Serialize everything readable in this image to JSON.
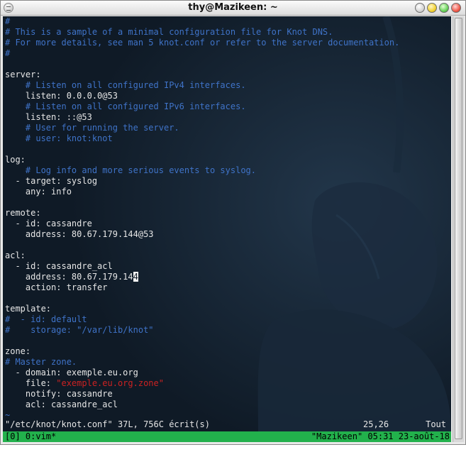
{
  "window": {
    "title": "thy@Mazikeen: ~"
  },
  "editor": {
    "lines": [
      {
        "text": "#",
        "kind": "comment"
      },
      {
        "text": "# This is a sample of a minimal configuration file for Knot DNS.",
        "kind": "comment"
      },
      {
        "text": "# For more details, see man 5 knot.conf or refer to the server documentation.",
        "kind": "comment"
      },
      {
        "text": "#",
        "kind": "comment"
      },
      {
        "text": "",
        "kind": "text"
      },
      {
        "text": "server:",
        "kind": "text"
      },
      {
        "text": "    # Listen on all configured IPv4 interfaces.",
        "kind": "comment"
      },
      {
        "text": "    listen: 0.0.0.0@53",
        "kind": "text"
      },
      {
        "text": "    # Listen on all configured IPv6 interfaces.",
        "kind": "comment"
      },
      {
        "text": "    listen: ::@53",
        "kind": "text"
      },
      {
        "text": "    # User for running the server.",
        "kind": "comment"
      },
      {
        "text": "    # user: knot:knot",
        "kind": "comment"
      },
      {
        "text": "",
        "kind": "text"
      },
      {
        "text": "log:",
        "kind": "text"
      },
      {
        "text": "    # Log info and more serious events to syslog.",
        "kind": "comment"
      },
      {
        "text": "  - target: syslog",
        "kind": "text"
      },
      {
        "text": "    any: info",
        "kind": "text"
      },
      {
        "text": "",
        "kind": "text"
      },
      {
        "text": "remote:",
        "kind": "text"
      },
      {
        "text": "  - id: cassandre",
        "kind": "text"
      },
      {
        "text": "    address: 80.67.179.144@53",
        "kind": "text"
      },
      {
        "text": "",
        "kind": "text"
      },
      {
        "text": "acl:",
        "kind": "text"
      },
      {
        "text": "  - id: cassandre_acl",
        "kind": "text"
      },
      {
        "text": "    address: 80.67.179.14",
        "kind": "cursor",
        "cursor_char": "4"
      },
      {
        "text": "    action: transfer",
        "kind": "text"
      },
      {
        "text": "",
        "kind": "text"
      },
      {
        "text": "template:",
        "kind": "text"
      },
      {
        "text": "#  - id: default",
        "kind": "comment"
      },
      {
        "text": "#    storage: \"/var/lib/knot\"",
        "kind": "comment"
      },
      {
        "text": "",
        "kind": "text"
      },
      {
        "text": "zone:",
        "kind": "text"
      },
      {
        "text": "# Master zone.",
        "kind": "comment"
      },
      {
        "text": "  - domain: exemple.eu.org",
        "kind": "text"
      },
      {
        "text": "    file: ",
        "kind": "string",
        "string_value": "\"exemple.eu.org.zone\""
      },
      {
        "text": "    notify: cassandre",
        "kind": "text"
      },
      {
        "text": "    acl: cassandre_acl",
        "kind": "text"
      },
      {
        "text": "~",
        "kind": "tilde"
      }
    ]
  },
  "vim_status": {
    "file_message": "\"/etc/knot/knot.conf\" 37L, 756C écrit(s)",
    "cursor_position": "25,26",
    "scroll_percent": "Tout"
  },
  "tmux_status": {
    "left": "[0] 0:vim*",
    "right": "\"Mazikeen\" 05:31 23-août-18"
  },
  "colors": {
    "terminal_bg": "#0f1a26",
    "comment": "#3f73c8",
    "string": "#cc2222",
    "tmux_bar": "#22b14c"
  }
}
